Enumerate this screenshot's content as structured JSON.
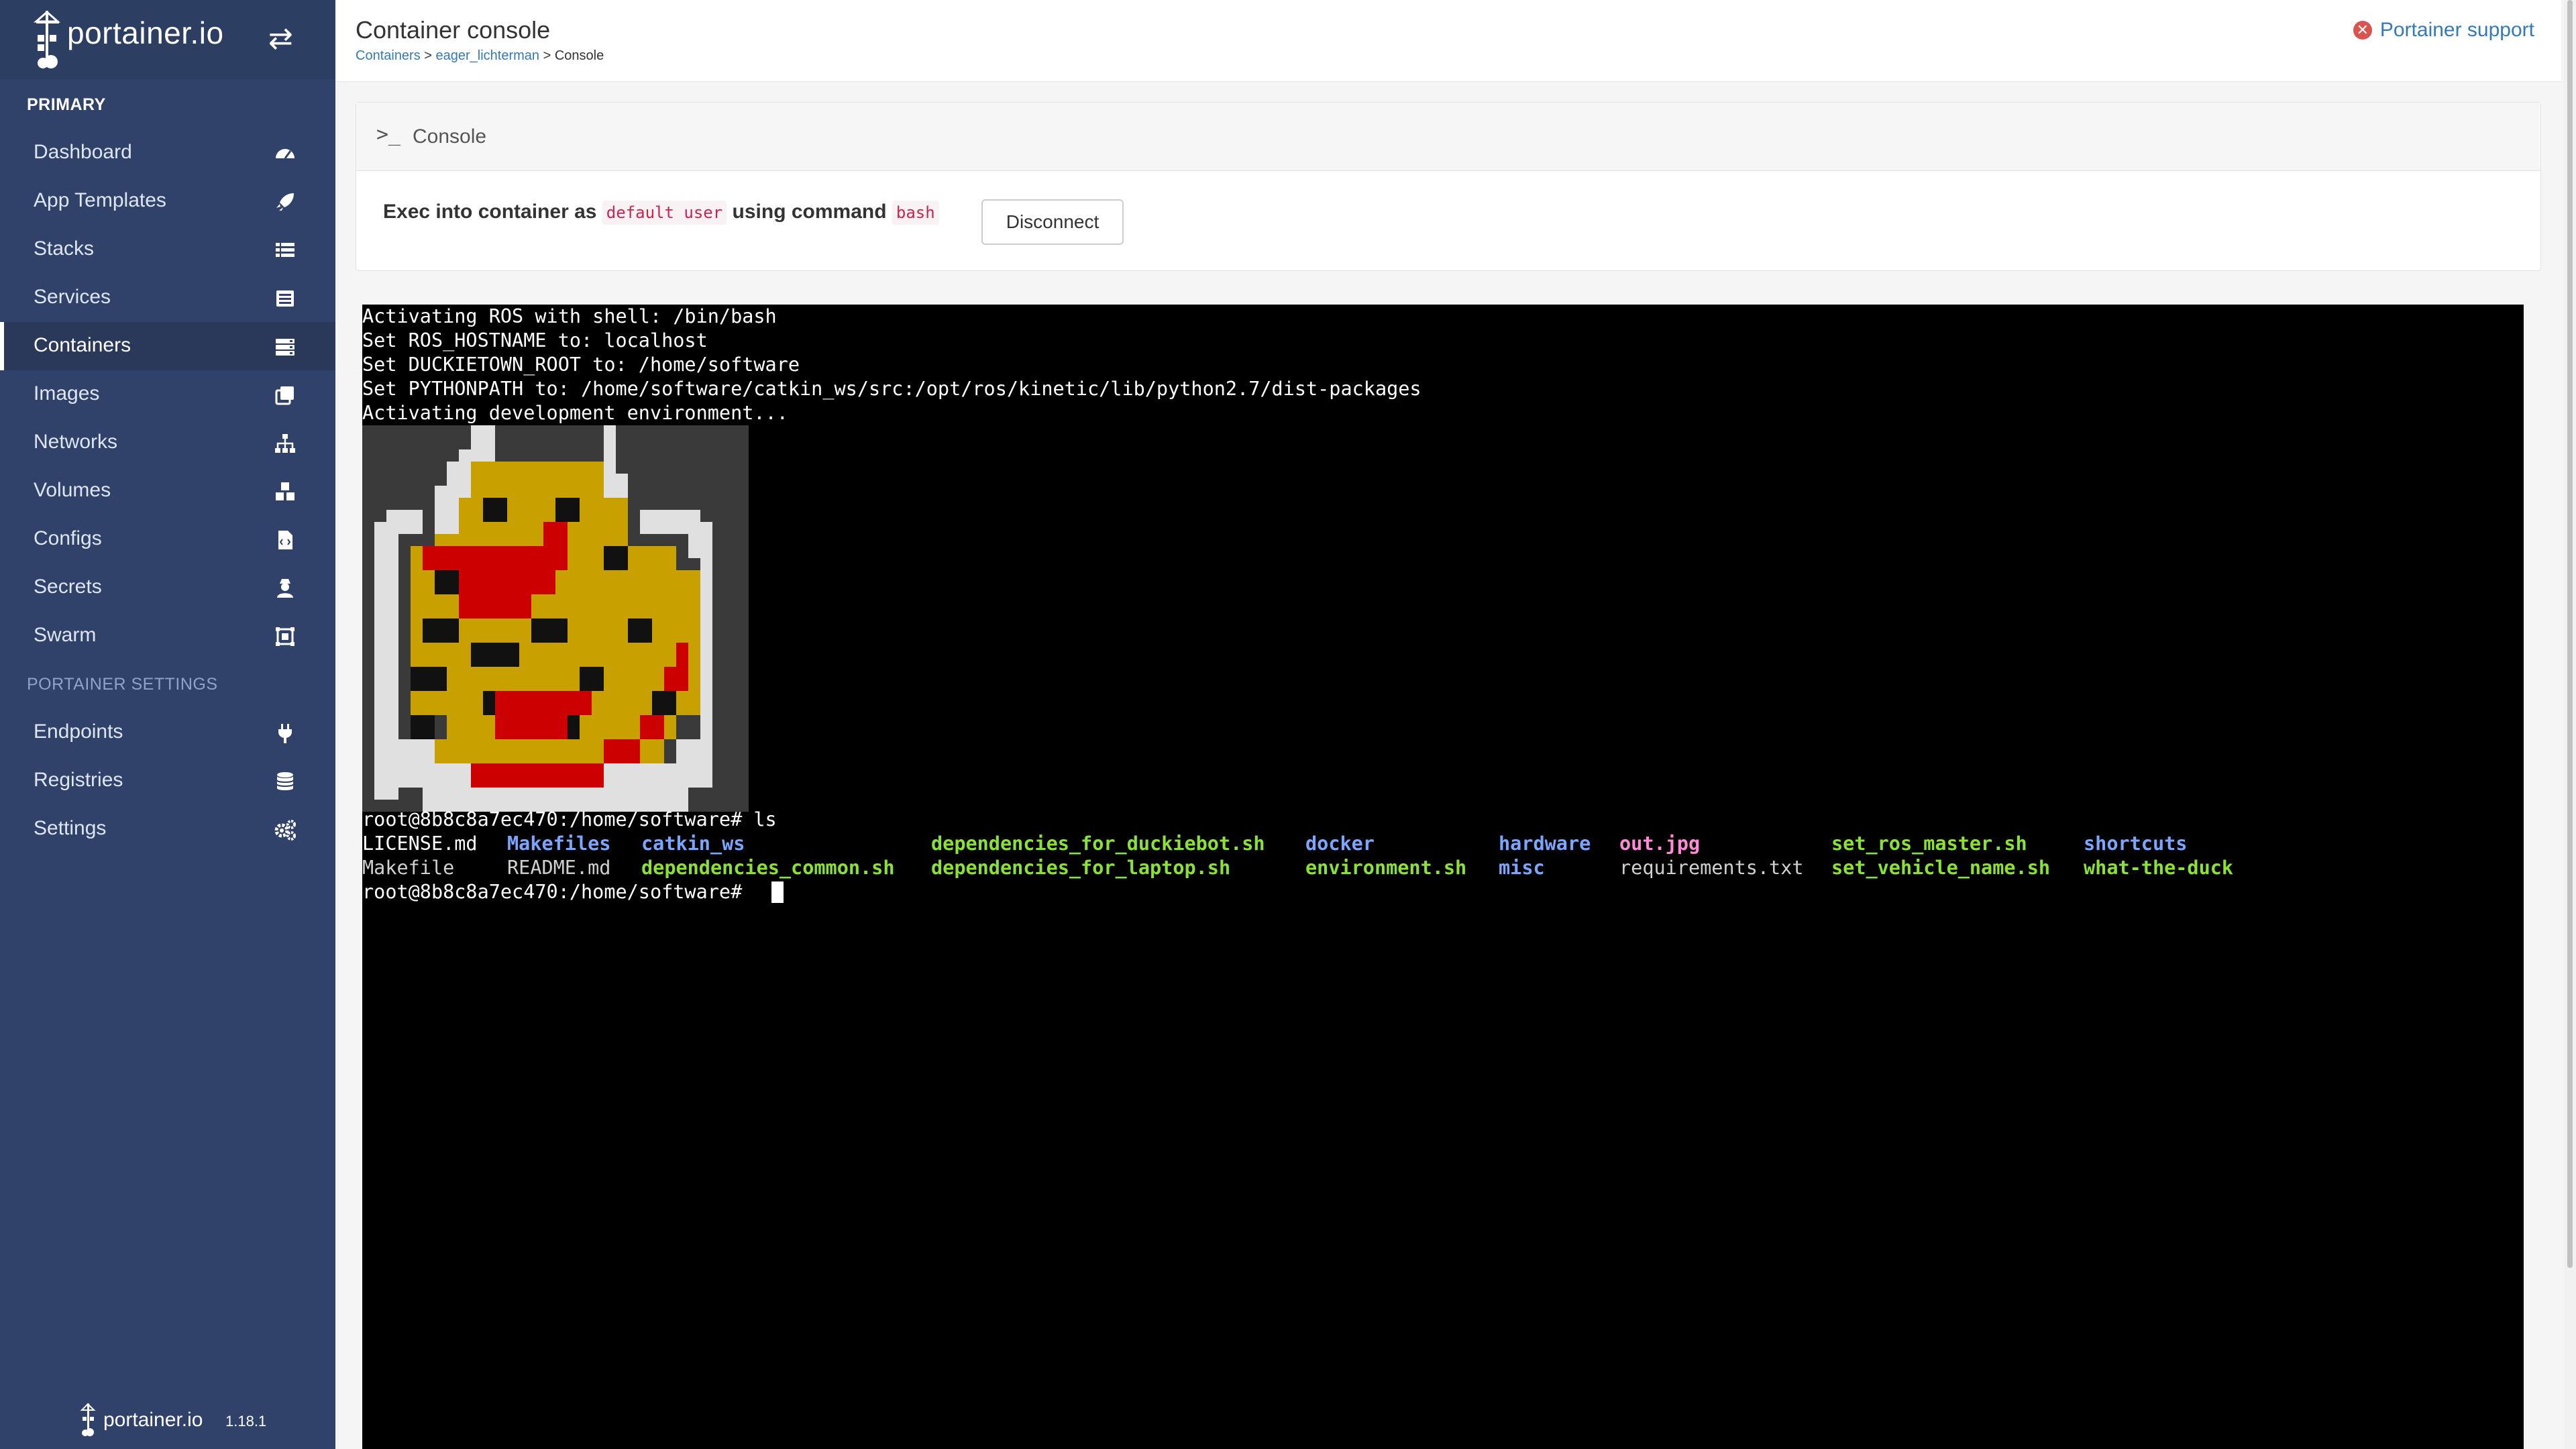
{
  "brand": {
    "name": "portainer.io",
    "toggle_icon": "exchange-icon"
  },
  "sidebar": {
    "heading_primary": "PRIMARY",
    "heading_settings": "PORTAINER SETTINGS",
    "items": [
      {
        "label": "Dashboard",
        "icon": "dashboard-icon"
      },
      {
        "label": "App Templates",
        "icon": "rocket-icon"
      },
      {
        "label": "Stacks",
        "icon": "list-icon"
      },
      {
        "label": "Services",
        "icon": "list-alt-icon"
      },
      {
        "label": "Containers",
        "icon": "server-icon",
        "active": true
      },
      {
        "label": "Images",
        "icon": "clone-icon"
      },
      {
        "label": "Networks",
        "icon": "sitemap-icon"
      },
      {
        "label": "Volumes",
        "icon": "cubes-icon"
      },
      {
        "label": "Configs",
        "icon": "file-code-icon"
      },
      {
        "label": "Secrets",
        "icon": "user-secret-icon"
      },
      {
        "label": "Swarm",
        "icon": "object-group-icon"
      }
    ],
    "settings_items": [
      {
        "label": "Endpoints",
        "icon": "plug-icon"
      },
      {
        "label": "Registries",
        "icon": "database-icon"
      },
      {
        "label": "Settings",
        "icon": "cogs-icon"
      }
    ],
    "footer": {
      "name": "portainer.io",
      "version": "1.18.1"
    }
  },
  "header": {
    "title": "Container console",
    "breadcrumb": {
      "containers": "Containers",
      "sep1": " > ",
      "container": "eager_lichterman",
      "sep2": " > ",
      "current": "Console"
    },
    "support": "Portainer support"
  },
  "panel": {
    "title": "Console",
    "exec_prefix": "Exec into container as",
    "user": "default user",
    "using": "using command",
    "command": "bash",
    "disconnect": "Disconnect"
  },
  "terminal": {
    "lines": [
      "Activating ROS with shell: /bin/bash",
      "Set ROS_HOSTNAME to: localhost",
      "Set DUCKIETOWN_ROOT to: /home/software",
      "Set PYTHONPATH to: /home/software/catkin_ws/src:/opt/ros/kinetic/lib/python2.7/dist-packages",
      "Activating development environment..."
    ],
    "prompt_ls": "root@8b8c8a7ec470:/home/software# ls",
    "ls_row1": [
      {
        "text": "LICENSE.md",
        "color": "white"
      },
      {
        "text": "Makefiles",
        "color": "blue"
      },
      {
        "text": "catkin_ws",
        "color": "blue"
      },
      {
        "text": "dependencies_for_duckiebot.sh",
        "color": "green"
      },
      {
        "text": "docker",
        "color": "blue"
      },
      {
        "text": "hardware",
        "color": "blue"
      },
      {
        "text": "out.jpg",
        "color": "pink"
      },
      {
        "text": "set_ros_master.sh",
        "color": "green"
      },
      {
        "text": "shortcuts",
        "color": "blue"
      }
    ],
    "ls_row2": [
      {
        "text": "Makefile",
        "color": "gray"
      },
      {
        "text": "README.md",
        "color": "gray"
      },
      {
        "text": "dependencies_common.sh",
        "color": "green"
      },
      {
        "text": "dependencies_for_laptop.sh",
        "color": "green"
      },
      {
        "text": "environment.sh",
        "color": "green"
      },
      {
        "text": "misc",
        "color": "blue"
      },
      {
        "text": "requirements.txt",
        "color": "gray"
      },
      {
        "text": "set_vehicle_name.sh",
        "color": "green"
      },
      {
        "text": "what-the-duck",
        "color": "green"
      }
    ],
    "prompt_final": "root@8b8c8a7ec470:/home/software# "
  },
  "colors": {
    "sidebar_bg": "#30426a",
    "link": "#337ab7",
    "duck_yellow": "#c8a000",
    "duck_red": "#cc0000",
    "duck_white": "#e0e0e0",
    "duck_bg": "#3a3a3a"
  }
}
